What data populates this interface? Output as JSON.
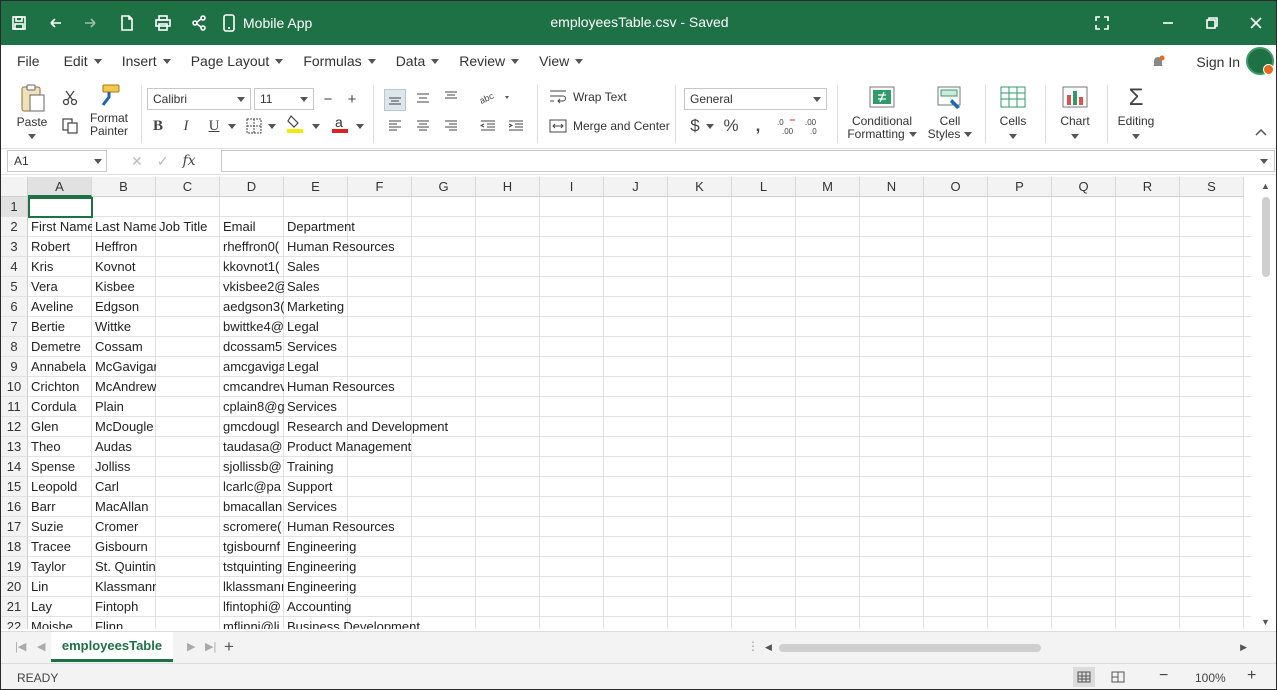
{
  "titlebar": {
    "mobile_label": "Mobile App",
    "title": "employeesTable.csv - Saved"
  },
  "menu": {
    "items": [
      "File",
      "Edit",
      "Insert",
      "Page Layout",
      "Formulas",
      "Data",
      "Review",
      "View"
    ],
    "sign_in": "Sign In"
  },
  "ribbon": {
    "paste": "Paste",
    "format_painter_1": "Format",
    "format_painter_2": "Painter",
    "font_name": "Calibri",
    "font_size": "11",
    "wrap_text": "Wrap Text",
    "merge_center": "Merge and Center",
    "number_format": "General",
    "cond_fmt_1": "Conditional",
    "cond_fmt_2": "Formatting",
    "cell_styles_1": "Cell",
    "cell_styles_2": "Styles",
    "cells": "Cells",
    "chart": "Chart",
    "editing": "Editing",
    "font_color": "#d22",
    "fill_color": "#f5e60b"
  },
  "formula_bar": {
    "name_box": "A1",
    "fx": "fx",
    "value": ""
  },
  "grid": {
    "columns": [
      "A",
      "B",
      "C",
      "D",
      "E",
      "F",
      "G",
      "H",
      "I",
      "J",
      "K",
      "L",
      "M",
      "N",
      "O",
      "P",
      "Q",
      "R",
      "S"
    ],
    "rows": [
      "1",
      "2",
      "3",
      "4",
      "5",
      "6",
      "7",
      "8",
      "9",
      "10",
      "11",
      "12",
      "13",
      "14",
      "15",
      "16",
      "17",
      "18",
      "19",
      "20",
      "21",
      "22"
    ],
    "header_row": {
      "a": "First Name",
      "b": "Last Name",
      "c": "Job Title",
      "d": "Email",
      "e": "Department"
    },
    "data": [
      {
        "a": "Robert",
        "b": "Heffron",
        "d": "rheffron0(",
        "e": "Human Resources"
      },
      {
        "a": "Kris",
        "b": "Kovnot",
        "d": "kkovnot1(",
        "e": "Sales"
      },
      {
        "a": "Vera",
        "b": "Kisbee",
        "d": "vkisbee2@",
        "e": "Sales"
      },
      {
        "a": "Aveline",
        "b": "Edgson",
        "d": "aedgson3(",
        "e": "Marketing"
      },
      {
        "a": "Bertie",
        "b": "Wittke",
        "d": "bwittke4@",
        "e": "Legal"
      },
      {
        "a": "Demetre",
        "b": "Cossam",
        "d": "dcossam5",
        "e": "Services"
      },
      {
        "a": "Annabela",
        "b": "McGavigan",
        "d": "amcgaviga",
        "e": "Legal"
      },
      {
        "a": "Crichton",
        "b": "McAndrew",
        "d": "cmcandrev",
        "e": "Human Resources"
      },
      {
        "a": "Cordula",
        "b": "Plain",
        "d": "cplain8@g",
        "e": "Services"
      },
      {
        "a": "Glen",
        "b": "McDougle",
        "d": "gmcdougl",
        "e": "Research and Development"
      },
      {
        "a": "Theo",
        "b": "Audas",
        "d": "taudasa@",
        "e": "Product Management"
      },
      {
        "a": "Spense",
        "b": "Jolliss",
        "d": "sjollissb@",
        "e": "Training"
      },
      {
        "a": "Leopold",
        "b": "Carl",
        "d": "lcarlc@pa",
        "e": "Support"
      },
      {
        "a": "Barr",
        "b": "MacAllan",
        "d": "bmacallan",
        "e": "Services"
      },
      {
        "a": "Suzie",
        "b": "Cromer",
        "d": "scromere(",
        "e": "Human Resources"
      },
      {
        "a": "Tracee",
        "b": "Gisbourn",
        "d": "tgisbournf",
        "e": "Engineering"
      },
      {
        "a": "Taylor",
        "b": "St. Quintin",
        "d": "tstquinting",
        "e": "Engineering"
      },
      {
        "a": "Lin",
        "b": "Klassmann",
        "d": "lklassmanı",
        "e": "Engineering"
      },
      {
        "a": "Lay",
        "b": "Fintoph",
        "d": "lfintophi@",
        "e": "Accounting"
      },
      {
        "a": "Moishe",
        "b": "Flinn",
        "d": "mflinnj@li",
        "e": "Business Development"
      }
    ]
  },
  "sheets": {
    "active": "employeesTable"
  },
  "status": {
    "text": "READY",
    "zoom": "100%"
  }
}
